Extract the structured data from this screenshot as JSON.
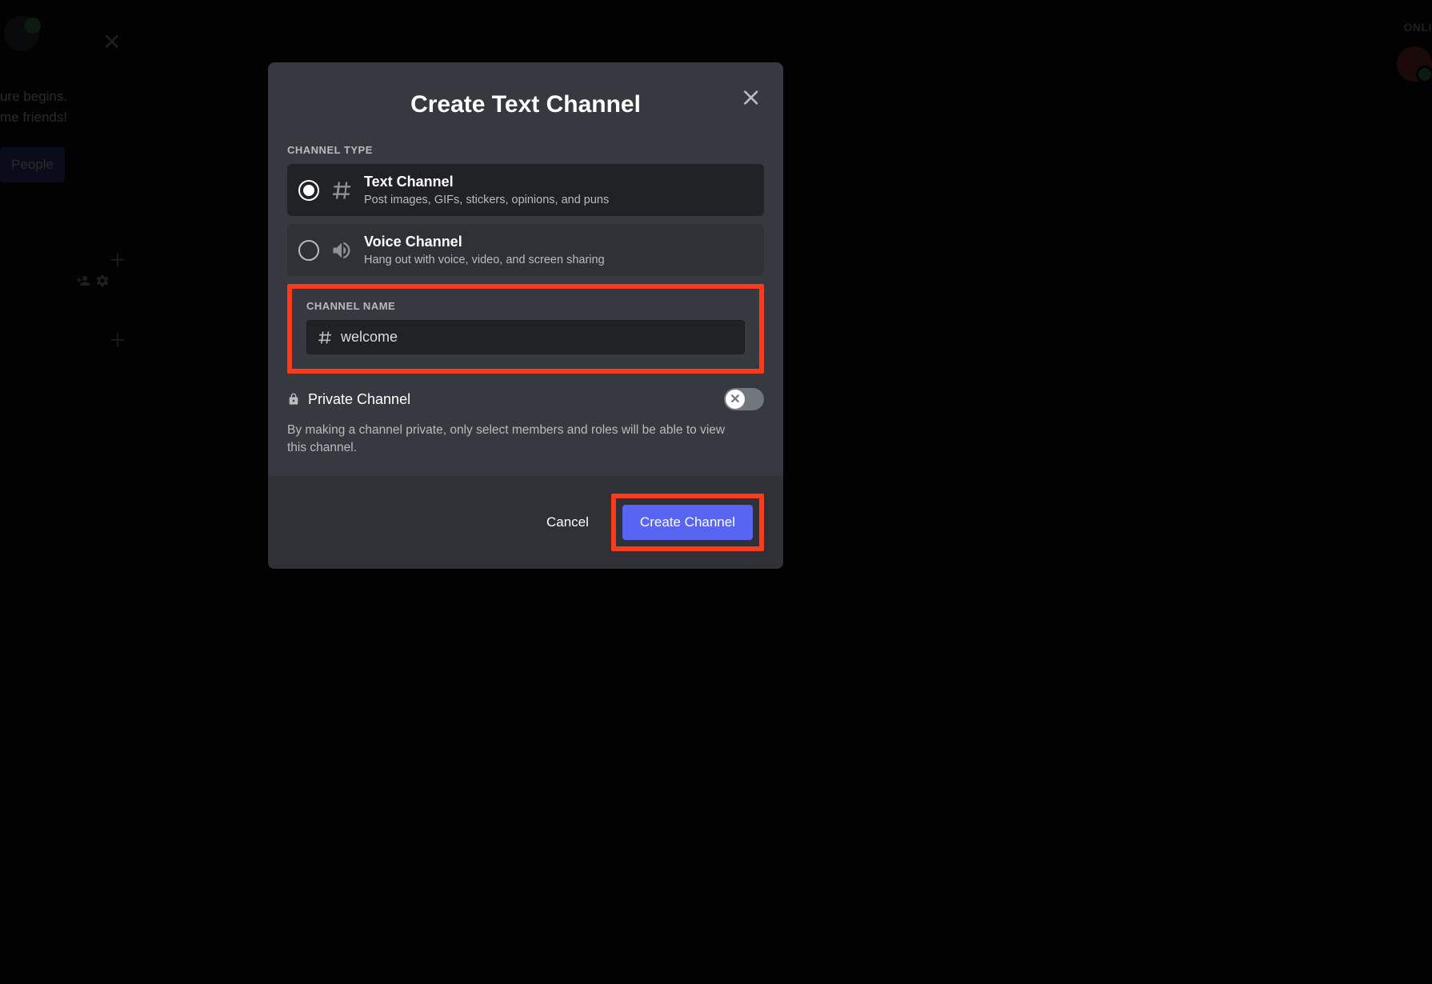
{
  "background": {
    "welcome_l1": "ure begins.",
    "welcome_l2": "me friends!",
    "invite_label": "People",
    "online_label": "ONLI"
  },
  "modal": {
    "title": "Create Text Channel",
    "channel_type_label": "CHANNEL TYPE",
    "types": [
      {
        "title": "Text Channel",
        "desc": "Post images, GIFs, stickers, opinions, and puns"
      },
      {
        "title": "Voice Channel",
        "desc": "Hang out with voice, video, and screen sharing"
      }
    ],
    "channel_name_label": "CHANNEL NAME",
    "channel_name_value": "welcome",
    "private_label": "Private Channel",
    "private_desc": "By making a channel private, only select members and roles will be able to view this channel.",
    "cancel_label": "Cancel",
    "create_label": "Create Channel"
  }
}
